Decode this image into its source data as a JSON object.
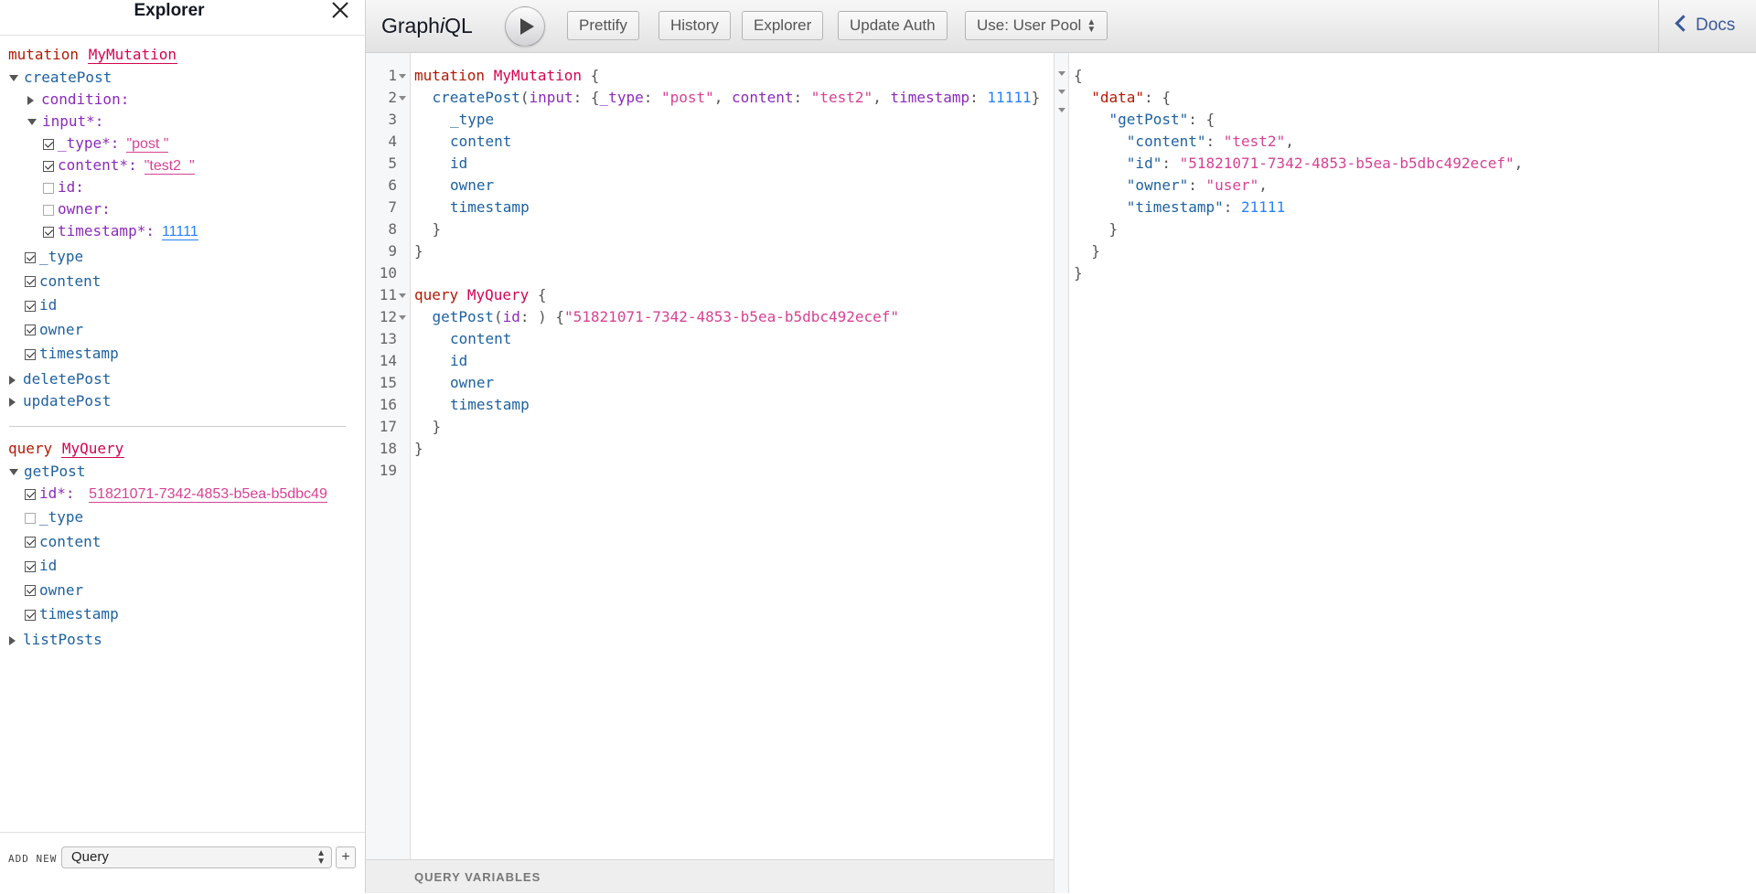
{
  "explorer": {
    "title": "Explorer",
    "mutation": {
      "keyword": "mutation",
      "name": "MyMutation",
      "root_field": "createPost",
      "condition_label": "condition:",
      "input_label": "input*:",
      "inputs": [
        {
          "name": "_type*:",
          "value": "\"post \"",
          "checked": true,
          "kind": "string"
        },
        {
          "name": "content*:",
          "value": "\"test2  \"",
          "checked": true,
          "kind": "string"
        },
        {
          "name": "id:",
          "value": "",
          "checked": false,
          "kind": "none"
        },
        {
          "name": "owner:",
          "value": "",
          "checked": false,
          "kind": "none"
        },
        {
          "name": "timestamp*:",
          "value": "11111",
          "checked": true,
          "kind": "number"
        }
      ],
      "fields": [
        "_type",
        "content",
        "id",
        "owner",
        "timestamp"
      ],
      "collapsed": [
        "deletePost",
        "updatePost"
      ]
    },
    "query": {
      "keyword": "query",
      "name": "MyQuery",
      "root_field": "getPost",
      "id_arg_label": "id*:",
      "id_arg_value": "51821071-7342-4853-b5ea-b5dbc49",
      "fields": [
        {
          "name": "_type",
          "checked": false
        },
        {
          "name": "content",
          "checked": true
        },
        {
          "name": "id",
          "checked": true
        },
        {
          "name": "owner",
          "checked": true
        },
        {
          "name": "timestamp",
          "checked": true
        }
      ],
      "collapsed": [
        "listPosts"
      ]
    },
    "footer": {
      "add_new_label": "ADD NEW",
      "operation_select": "Query",
      "add_button": "+"
    }
  },
  "toolbar": {
    "brand_pre": "Graph",
    "brand_i": "i",
    "brand_post": "QL",
    "prettify": "Prettify",
    "history": "History",
    "explorer": "Explorer",
    "update_auth": "Update Auth",
    "user_pool": "Use: User Pool",
    "docs": "Docs"
  },
  "editor": {
    "line_numbers": [
      "1",
      "2",
      "3",
      "4",
      "5",
      "6",
      "7",
      "8",
      "9",
      "10",
      "11",
      "12",
      "13",
      "14",
      "15",
      "16",
      "17",
      "18",
      "19"
    ],
    "lines": [
      {
        "kw": "mutation",
        "def": "MyMutation",
        "p": " {"
      },
      {
        "fld": "createPost",
        "p1": "(",
        "a1": "input",
        "p2": ": {",
        "a2": "_type",
        "p3": ": ",
        "s1": "\"post\"",
        "p4": ", ",
        "a3": "content",
        "p5": ": ",
        "s2": "\"test2\"",
        "p6": ", ",
        "a4": "timestamp",
        "p7": ": ",
        "n1": "11111",
        "p8": "}"
      },
      {
        "fld": "_type"
      },
      {
        "fld": "content"
      },
      {
        "fld": "id"
      },
      {
        "fld": "owner"
      },
      {
        "fld": "timestamp"
      },
      {
        "p": "}"
      },
      {
        "p": "}"
      },
      {
        "p": ""
      },
      {
        "kw": "query",
        "def": "MyQuery",
        "p": " {"
      },
      {
        "fld": "getPost",
        "p1": "(",
        "a1": "id",
        "p2": ": ",
        "s1": "\"51821071-7342-4853-b5ea-b5dbc492ecef\"",
        "p3": ") {"
      },
      {
        "fld": "content"
      },
      {
        "fld": "id"
      },
      {
        "fld": "owner"
      },
      {
        "fld": "timestamp"
      },
      {
        "p": "}"
      },
      {
        "p": "}"
      }
    ],
    "query_variables_label": "QUERY VARIABLES"
  },
  "result": {
    "open_brace": "{",
    "data_key": "\"data\"",
    "getpost_key": "\"getPost\"",
    "entries": [
      {
        "key": "\"content\"",
        "value": "\"test2\"",
        "kind": "string",
        "comma": ","
      },
      {
        "key": "\"id\"",
        "value": "\"51821071-7342-4853-b5ea-b5dbc492ecef\"",
        "kind": "string",
        "comma": ","
      },
      {
        "key": "\"owner\"",
        "value": "\"user\"",
        "kind": "string",
        "comma": ","
      },
      {
        "key": "\"timestamp\"",
        "value": "21111",
        "kind": "number",
        "comma": ""
      }
    ],
    "close_brace": "}"
  }
}
